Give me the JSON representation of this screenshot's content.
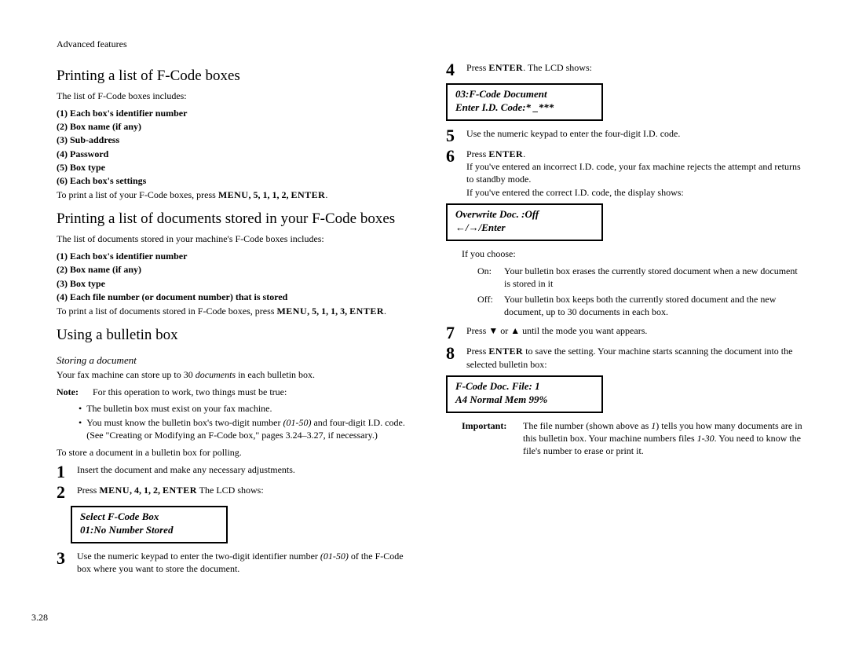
{
  "header": "Advanced features",
  "pageNumber": "3.28",
  "left": {
    "h1": "Printing a list of F-Code boxes",
    "intro1": "The list of F-Code boxes includes:",
    "list1": {
      "i1": "(1) Each box's identifier number",
      "i2": "(2) Box name (if any)",
      "i3": "(3) Sub-address",
      "i4": "(4) Password",
      "i5": "(5) Box type",
      "i6": "(6) Each box's settings"
    },
    "print1_a": "To print a list of your F-Code boxes, press ",
    "print1_b": "MENU",
    "print1_c": ", 5, 1, 1, 2, ",
    "print1_d": "ENTER",
    "print1_e": ".",
    "h2": "Printing a list of documents stored in your F-Code boxes",
    "intro2": "The list of documents stored in your machine's F-Code boxes includes:",
    "list2": {
      "i1": "(1) Each box's identifier number",
      "i2": "(2) Box name (if any)",
      "i3": "(3) Box type",
      "i4": "(4) Each file number (or document number) that is stored"
    },
    "print2_a": "To print a list of documents stored in F-Code boxes, press ",
    "print2_b": "MENU",
    "print2_c": ", 5, 1, 1, 3, ",
    "print2_d": "ENTER",
    "print2_e": ".",
    "h3": "Using a bulletin box",
    "subh": "Storing a document",
    "store1_a": "Your fax machine can store up to 30 ",
    "store1_b": "documents",
    "store1_c": " in each bulletin box.",
    "noteLbl": "Note:",
    "noteBody": "For this operation to work, two things must be true:",
    "bul1": "The bulletin box must exist on your fax machine.",
    "bul2_a": "You must know the bulletin box's two-digit number ",
    "bul2_b": "(01-50)",
    "bul2_c": " and four-digit ",
    "bul2_d": "I.D.",
    "bul2_e": " code. (See \"Creating or Modifying an F-Code box,\" pages 3.24–3.27, if necessary.)",
    "storeline": "To store a document in a bulletin box for polling.",
    "s1": "Insert the document and make any necessary adjustments.",
    "s2_a": "Press ",
    "s2_b": "MENU",
    "s2_c": ", 4, 1, 2, ",
    "s2_d": "ENTER",
    "s2_e": " The ",
    "s2_f": "LCD",
    "s2_g": " shows:",
    "lcd1_l1": "Select F-Code Box",
    "lcd1_l2": "01:No Number Stored",
    "s3_a": "Use the numeric keypad to enter the two-digit identifier number ",
    "s3_b": "(01-50)",
    "s3_c": " of the F-Code box where you want to store the document."
  },
  "right": {
    "s4_a": "Press ",
    "s4_b": "ENTER",
    "s4_c": ". The ",
    "s4_d": "LCD",
    "s4_e": " shows:",
    "lcd2_l1": "03:F-Code Document",
    "lcd2_l2": "Enter I.D. Code:*  _***",
    "s5_a": "Use the numeric keypad to enter the four-digit ",
    "s5_b": "I.D.",
    "s5_c": " code.",
    "s6_a": "Press ",
    "s6_b": "ENTER",
    "s6_c": ".",
    "s6_p1_a": "If you've entered an incorrect ",
    "s6_p1_b": "I.D.",
    "s6_p1_c": " code, your fax machine rejects the attempt and returns to standby mode.",
    "s6_p2_a": "If you've entered the correct ",
    "s6_p2_b": "I.D.",
    "s6_p2_c": " code, the display shows:",
    "lcd3_l1": "Overwrite Doc.  :Off",
    "lcd3_l2": "                  ←/→/Enter",
    "ifchoose": "If you choose:",
    "onLbl": "On:",
    "onBody": "Your bulletin box erases the currently stored document when a new document is stored in it",
    "offLbl": "Off:",
    "offBody": "Your bulletin box keeps both the currently stored document and the new document, up to 30 documents in each box.",
    "s7": "Press ▼ or ▲ until the mode you want appears.",
    "s8_a": "Press ",
    "s8_b": "ENTER",
    "s8_c": " to save the setting. Your machine starts scanning the document into the selected bulletin box:",
    "lcd4_l1": "F-Code Doc.  File: 1",
    "lcd4_l2": "A4 Normal    Mem 99%",
    "impLbl": "Important:",
    "imp_a": "The file number (shown above as ",
    "imp_b": "1",
    "imp_c": ") tells you how many documents are in this bulletin box. Your machine numbers files ",
    "imp_d": "1-30",
    "imp_e": ". You need to know the file's number to erase or print it."
  }
}
